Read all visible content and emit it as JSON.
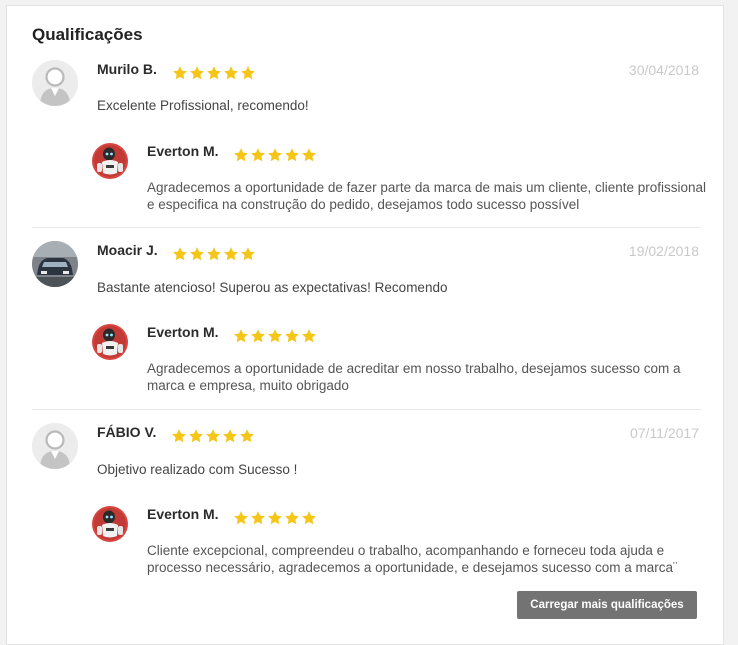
{
  "section": {
    "title": "Qualificações"
  },
  "reviews": [
    {
      "name": "Murilo B.",
      "rating": 5,
      "date": "30/04/2018",
      "comment": "Excelente Profissional, recomendo!",
      "avatar": "default-user-avatar",
      "reply": {
        "name": "Everton M.",
        "rating": 5,
        "avatar": "robot-avatar",
        "text": "Agradecemos a oportunidade de fazer parte da marca de mais um cliente, cliente profissional e especifica na construção do pedido, desejamos todo sucesso possível"
      }
    },
    {
      "name": "Moacir J.",
      "rating": 5,
      "date": "19/02/2018",
      "comment": "Bastante atencioso! Superou as expectativas! Recomendo",
      "avatar": "car-photo-avatar",
      "reply": {
        "name": "Everton M.",
        "rating": 5,
        "avatar": "robot-avatar",
        "text": "Agradecemos a oportunidade de acreditar em nosso trabalho, desejamos sucesso com a marca e empresa, muito obrigado"
      }
    },
    {
      "name": "FÁBIO V.",
      "rating": 5,
      "date": "07/11/2017",
      "comment": "Objetivo realizado com Sucesso !",
      "avatar": "default-user-avatar",
      "reply": {
        "name": "Everton M.",
        "rating": 5,
        "avatar": "robot-avatar",
        "text": "Cliente excepcional, compreendeu o trabalho, acompanhando e forneceu toda ajuda e processo necessário, agradecemos a oportunidade, e desejamos sucesso com a marca¨"
      }
    }
  ],
  "load_more_label": "Carregar mais qualificações",
  "colors": {
    "star": "#f5c518",
    "button": "#737373",
    "date": "#c9c9c9"
  }
}
